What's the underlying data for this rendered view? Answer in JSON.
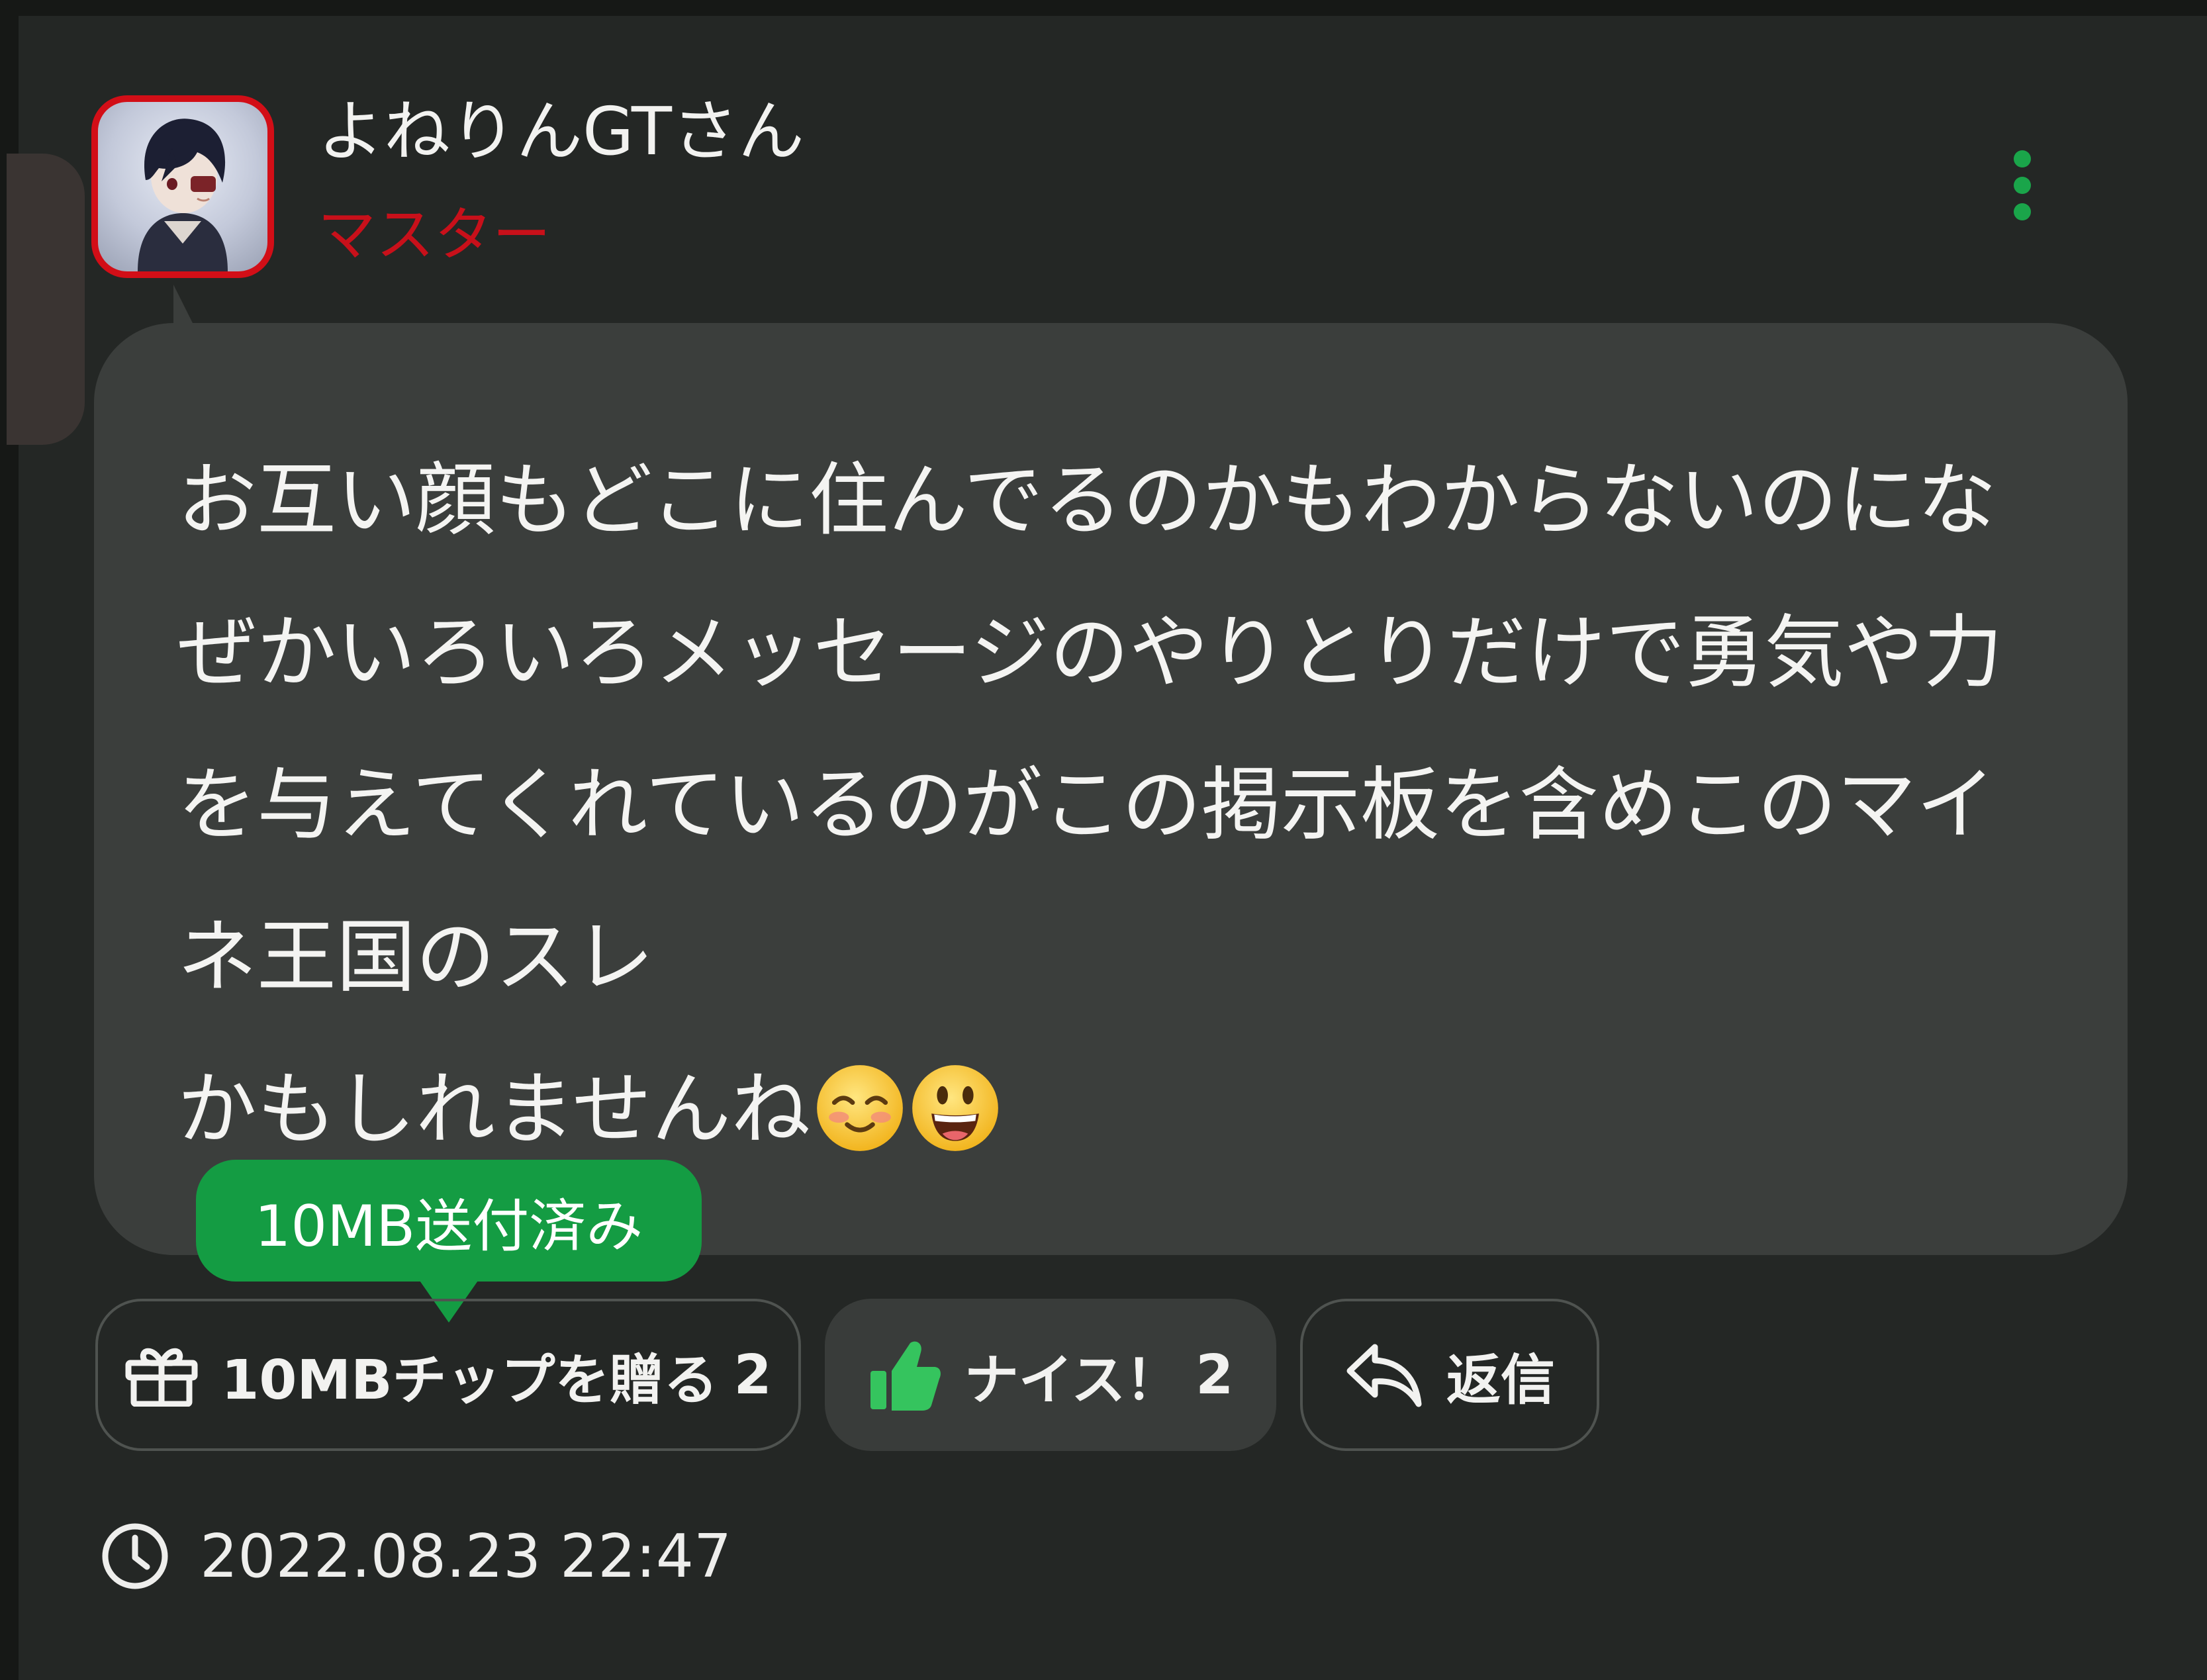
{
  "post": {
    "author": {
      "name": "よねりんGTさん",
      "role": "マスター"
    },
    "message_lines": [
      "お互い顔もどこに住んでるのかもわからないのにな",
      "ぜかいろいろメッセージのやりとりだけで勇気や力",
      "を与えてくれているのがこの掲示板を含めこのマイ",
      "ネ王国のスレ",
      "かもしれませんね"
    ],
    "emojis": [
      "smiling-face-with-smiling-eyes",
      "grinning-face-with-big-eyes"
    ],
    "tip_badge": "10MB送付済み",
    "actions": {
      "tip": {
        "label": "10MBチップを贈る",
        "count": "2",
        "icon": "gift-icon"
      },
      "nice": {
        "label": "ナイス！",
        "count": "2",
        "icon": "thumbs-up-icon"
      },
      "reply": {
        "label": "返信",
        "icon": "reply-arrow-icon"
      }
    },
    "timestamp": "2022.08.23 22:47"
  },
  "colors": {
    "background": "#242725",
    "bubble": "#3b3e3c",
    "accent_green": "#149c43",
    "role_red": "#c8101a",
    "avatar_border": "#d20e17"
  }
}
